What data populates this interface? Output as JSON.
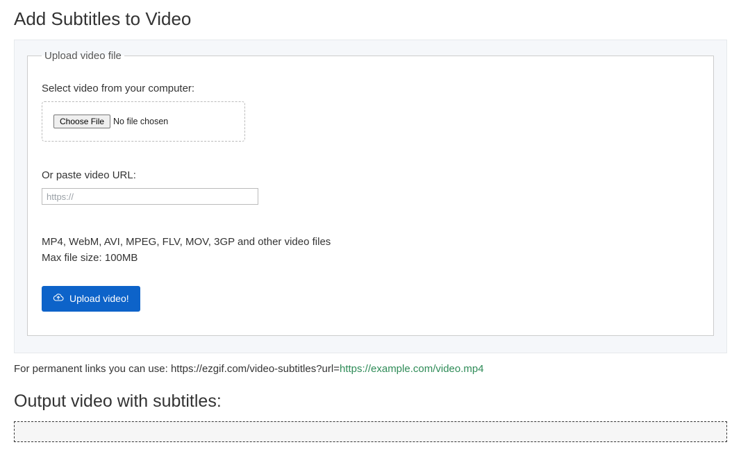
{
  "page": {
    "title": "Add Subtitles to Video",
    "output_heading": "Output video with subtitles:"
  },
  "upload": {
    "legend": "Upload video file",
    "select_label": "Select video from your computer:",
    "choose_button": "Choose File",
    "no_file": "No file chosen",
    "url_label": "Or paste video URL:",
    "url_placeholder": "https://",
    "formats_line": "MP4, WebM, AVI, MPEG, FLV, MOV, 3GP and other video files",
    "maxsize_line": "Max file size: 100MB",
    "submit": "Upload video!"
  },
  "permalink": {
    "prefix": "For permanent links you can use: https://ezgif.com/video-subtitles?url=",
    "example": "https://example.com/video.mp4"
  }
}
